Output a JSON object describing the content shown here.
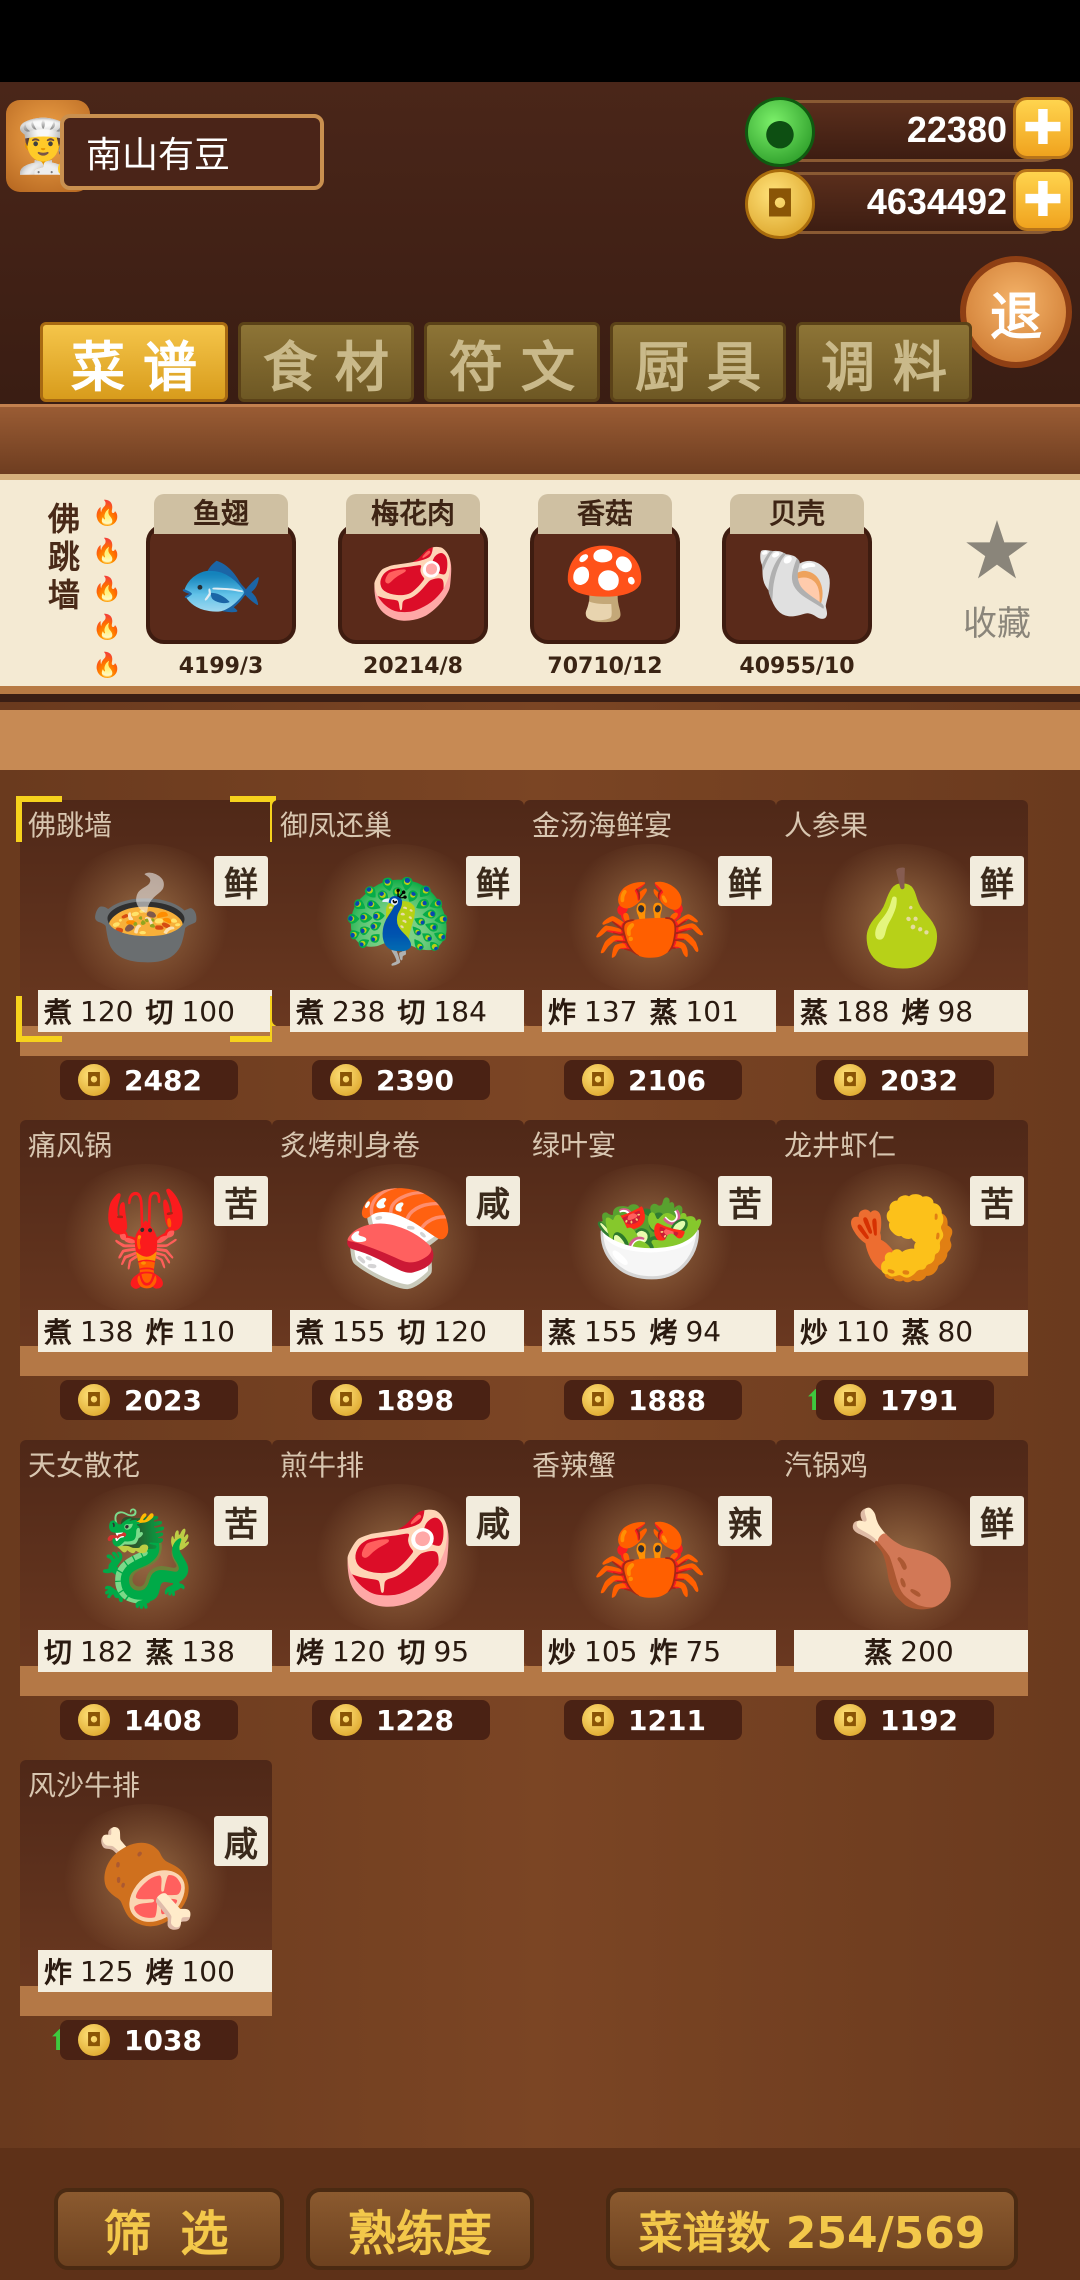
{
  "player": {
    "name": "南山有豆",
    "avatar_icon": "chef-avatar-icon"
  },
  "currency": {
    "jade": "22380",
    "coins": "4634492",
    "plus": "✚"
  },
  "exit_label": "退",
  "tabs": [
    "菜谱",
    "食材",
    "符文",
    "厨具",
    "调料"
  ],
  "detail": {
    "name": "佛跳墙",
    "fire_level": 5,
    "ingredients": [
      {
        "name": "鱼翅",
        "count": "4199/3",
        "icon": "fin-icon"
      },
      {
        "name": "梅花肉",
        "count": "20214/8",
        "icon": "meat-icon"
      },
      {
        "name": "香菇",
        "count": "70710/12",
        "icon": "mushroom-icon"
      },
      {
        "name": "贝壳",
        "count": "40955/10",
        "icon": "shell-icon"
      }
    ],
    "favorite_label": "收藏"
  },
  "recipes": [
    {
      "name": "佛跳墙",
      "flavor": "鲜",
      "s1": "煮",
      "v1": "120",
      "s2": "切",
      "v2": "100",
      "price": "2482",
      "emoji": "🍲",
      "selected": true
    },
    {
      "name": "御凤还巢",
      "flavor": "鲜",
      "s1": "煮",
      "v1": "238",
      "s2": "切",
      "v2": "184",
      "price": "2390",
      "emoji": "🦚"
    },
    {
      "name": "金汤海鲜宴",
      "flavor": "鲜",
      "s1": "炸",
      "v1": "137",
      "s2": "蒸",
      "v2": "101",
      "price": "2106",
      "emoji": "🦀"
    },
    {
      "name": "人参果",
      "flavor": "鲜",
      "s1": "蒸",
      "v1": "188",
      "s2": "烤",
      "v2": "98",
      "price": "2032",
      "emoji": "🍐"
    },
    {
      "name": "痛风锅",
      "flavor": "苦",
      "s1": "煮",
      "v1": "138",
      "s2": "炸",
      "v2": "110",
      "price": "2023",
      "emoji": "🦞"
    },
    {
      "name": "炙烤刺身卷",
      "flavor": "咸",
      "s1": "煮",
      "v1": "155",
      "s2": "切",
      "v2": "120",
      "price": "1898",
      "emoji": "🍣"
    },
    {
      "name": "绿叶宴",
      "flavor": "苦",
      "s1": "蒸",
      "v1": "155",
      "s2": "烤",
      "v2": "94",
      "price": "1888",
      "emoji": "🥗"
    },
    {
      "name": "龙井虾仁",
      "flavor": "苦",
      "s1": "炒",
      "v1": "110",
      "s2": "蒸",
      "v2": "80",
      "price": "1791",
      "emoji": "🍤",
      "up": true
    },
    {
      "name": "天女散花",
      "flavor": "苦",
      "s1": "切",
      "v1": "182",
      "s2": "蒸",
      "v2": "138",
      "price": "1408",
      "emoji": "🐉"
    },
    {
      "name": "煎牛排",
      "flavor": "咸",
      "s1": "烤",
      "v1": "120",
      "s2": "切",
      "v2": "95",
      "price": "1228",
      "emoji": "🥩"
    },
    {
      "name": "香辣蟹",
      "flavor": "辣",
      "s1": "炒",
      "v1": "105",
      "s2": "炸",
      "v2": "75",
      "price": "1211",
      "emoji": "🦀"
    },
    {
      "name": "汽锅鸡",
      "flavor": "鲜",
      "s1": "蒸",
      "v1": "200",
      "s2": "",
      "v2": "",
      "price": "1192",
      "emoji": "🍗"
    },
    {
      "name": "风沙牛排",
      "flavor": "咸",
      "s1": "炸",
      "v1": "125",
      "s2": "烤",
      "v2": "100",
      "price": "1038",
      "emoji": "🍖",
      "up": true
    }
  ],
  "bottom": {
    "filter": "筛 选",
    "mastery": "熟练度",
    "recipe_count": "菜谱数 254/569"
  }
}
